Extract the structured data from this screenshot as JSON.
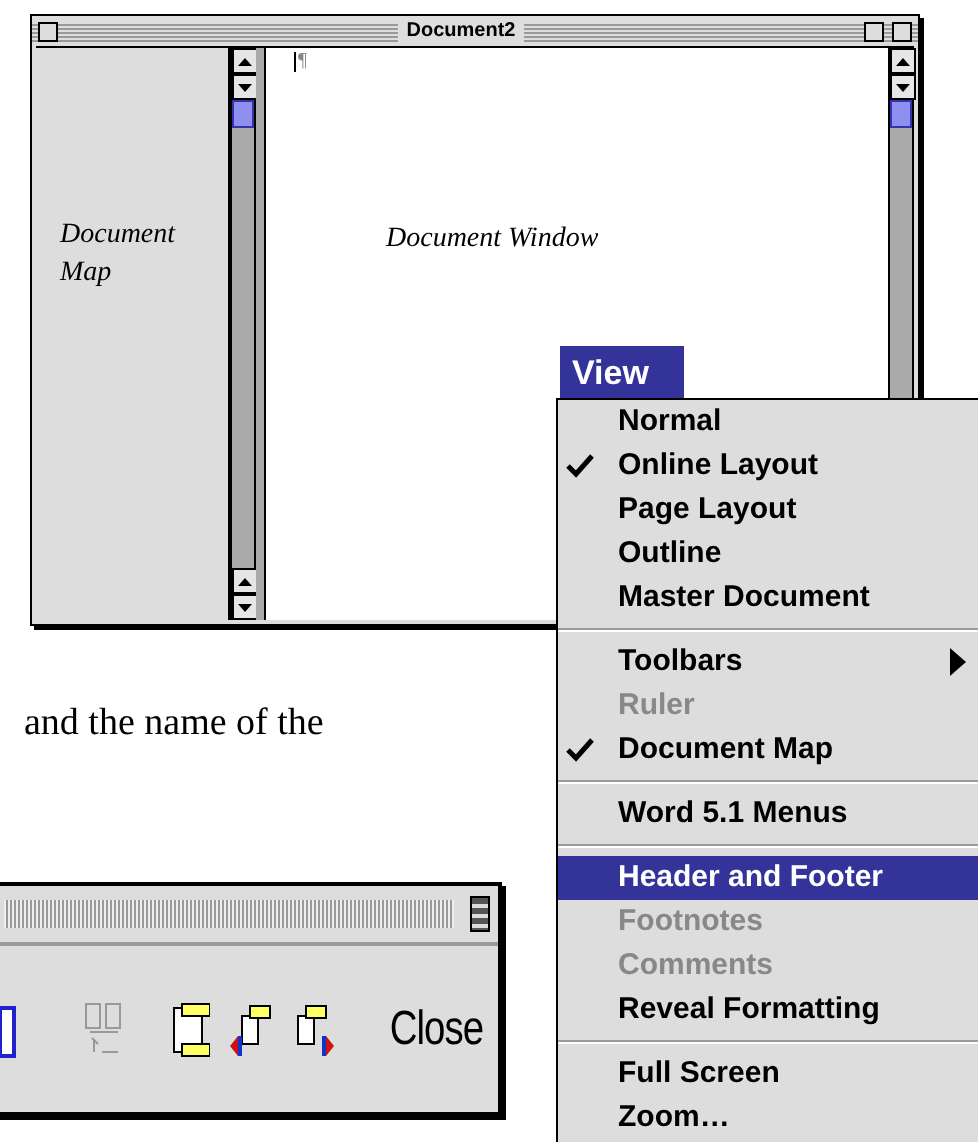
{
  "window": {
    "title": "Document2",
    "document_map": {
      "label": "Document Map"
    },
    "document": {
      "mark": "¶",
      "label": "Document Window"
    }
  },
  "menu": {
    "title": "View",
    "selected": true,
    "items": [
      {
        "kind": "item",
        "label": "Normal",
        "checked": false,
        "disabled": false,
        "selected": false
      },
      {
        "kind": "item",
        "label": "Online Layout",
        "checked": true,
        "disabled": false,
        "selected": false
      },
      {
        "kind": "item",
        "label": "Page Layout",
        "checked": false,
        "disabled": false,
        "selected": false
      },
      {
        "kind": "item",
        "label": "Outline",
        "checked": false,
        "disabled": false,
        "selected": false
      },
      {
        "kind": "item",
        "label": "Master Document",
        "checked": false,
        "disabled": false,
        "selected": false
      },
      {
        "kind": "separator"
      },
      {
        "kind": "submenu",
        "label": "Toolbars",
        "checked": false,
        "disabled": false,
        "selected": false
      },
      {
        "kind": "item",
        "label": "Ruler",
        "checked": false,
        "disabled": true,
        "selected": false
      },
      {
        "kind": "item",
        "label": "Document Map",
        "checked": true,
        "disabled": false,
        "selected": false
      },
      {
        "kind": "separator"
      },
      {
        "kind": "item",
        "label": "Word 5.1 Menus",
        "checked": false,
        "disabled": false,
        "selected": false
      },
      {
        "kind": "separator"
      },
      {
        "kind": "item",
        "label": "Header and Footer",
        "checked": false,
        "disabled": false,
        "selected": true
      },
      {
        "kind": "item",
        "label": "Footnotes",
        "checked": false,
        "disabled": true,
        "selected": false
      },
      {
        "kind": "item",
        "label": "Comments",
        "checked": false,
        "disabled": true,
        "selected": false
      },
      {
        "kind": "item",
        "label": "Reveal Formatting",
        "checked": false,
        "disabled": false,
        "selected": false
      },
      {
        "kind": "separator"
      },
      {
        "kind": "item",
        "label": "Full Screen",
        "checked": false,
        "disabled": false,
        "selected": false
      },
      {
        "kind": "item",
        "label": "Zoom…",
        "checked": false,
        "disabled": false,
        "selected": false
      }
    ]
  },
  "body_text": "and the name of the",
  "toolbar": {
    "buttons": [
      {
        "kind": "page",
        "disabled": false
      },
      {
        "kind": "link",
        "disabled": true
      },
      {
        "kind": "switch",
        "disabled": false
      },
      {
        "kind": "previous",
        "disabled": false
      },
      {
        "kind": "next",
        "disabled": false
      }
    ],
    "close": "Close"
  }
}
